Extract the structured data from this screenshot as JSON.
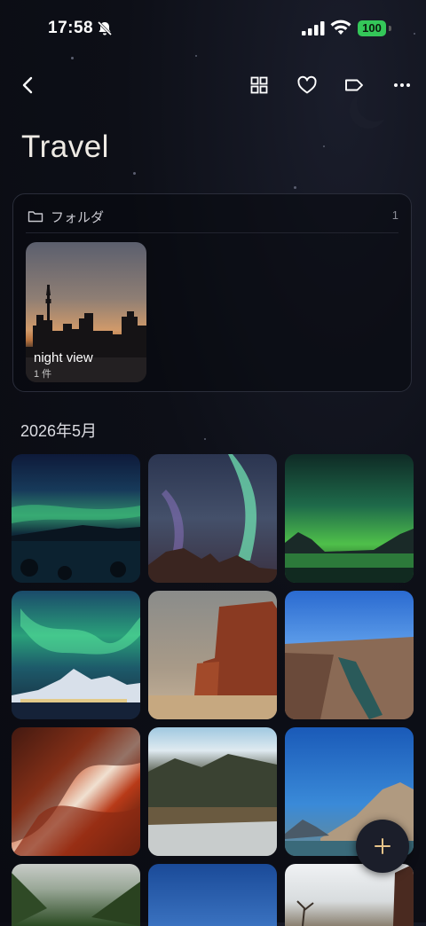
{
  "status_bar": {
    "time": "17:58",
    "battery": "100"
  },
  "toolbar": {
    "back_icon": "chevron-left-icon",
    "grid_icon": "grid-icon",
    "favorite_icon": "heart-icon",
    "tag_icon": "tag-icon",
    "more_icon": "more-horizontal-icon"
  },
  "page": {
    "title": "Travel"
  },
  "folders": {
    "label": "フォルダ",
    "count": "1",
    "items": [
      {
        "name": "night view",
        "count_label": "1 件"
      }
    ]
  },
  "section": {
    "date_header": "2026年5月"
  },
  "photos": [
    "aurora-lake-night",
    "aurora-over-mountain-peaks",
    "aurora-reflection-lake",
    "aurora-snowy-village",
    "red-cliff-desert",
    "river-canyon",
    "red-slot-canyon",
    "mountain-valley-sun",
    "rocky-mountain-lake",
    "green-mountain-valley",
    "blue-sky",
    "bare-tree-rock"
  ],
  "fab": {
    "icon": "plus-icon"
  }
}
